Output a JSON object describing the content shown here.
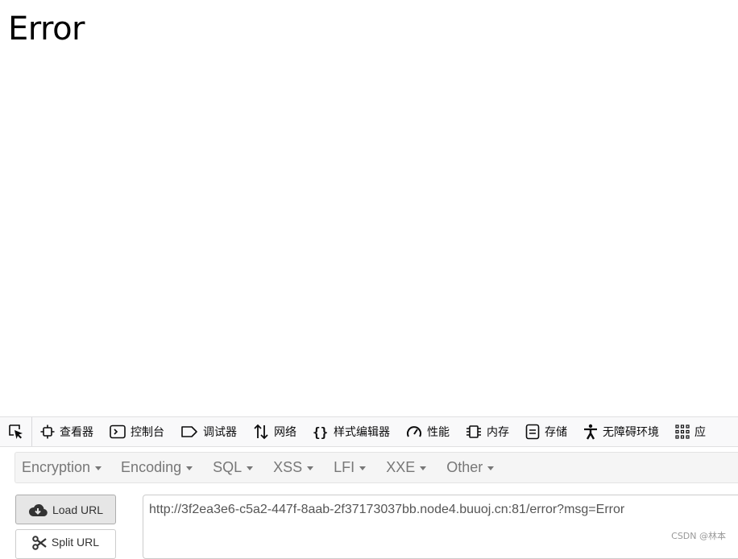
{
  "page": {
    "title": "Error"
  },
  "devtools": {
    "tabs": [
      {
        "label": "查看器",
        "icon": "inspector-icon"
      },
      {
        "label": "控制台",
        "icon": "console-icon"
      },
      {
        "label": "调试器",
        "icon": "debugger-icon"
      },
      {
        "label": "网络",
        "icon": "network-icon"
      },
      {
        "label": "样式编辑器",
        "icon": "style-editor-icon"
      },
      {
        "label": "性能",
        "icon": "performance-icon"
      },
      {
        "label": "内存",
        "icon": "memory-icon"
      },
      {
        "label": "存储",
        "icon": "storage-icon"
      },
      {
        "label": "无障碍环境",
        "icon": "accessibility-icon"
      },
      {
        "label": "应",
        "icon": "application-icon"
      }
    ]
  },
  "hackbar": {
    "menu": [
      "Encryption",
      "Encoding",
      "SQL",
      "XSS",
      "LFI",
      "XXE",
      "Other"
    ],
    "load_label": "Load URL",
    "split_label": "Split URL",
    "url": "http://3f2ea3e6-c5a2-447f-8aab-2f37173037bb.node4.buuoj.cn:81/error?msg=Error"
  },
  "watermark": "CSDN @林本",
  "colors": {
    "toolbar_bg": "#f9f9fa",
    "menu_bg": "#f5f5f5",
    "menu_text": "#777777",
    "button_bg": "#e6e6e6"
  }
}
